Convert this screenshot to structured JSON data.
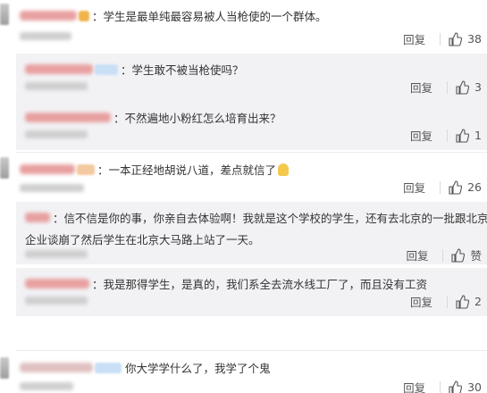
{
  "comments": [
    {
      "text": "学生是最单纯最容易被人当枪使的一个群体。",
      "reply": "回复",
      "likes": "38"
    },
    {
      "text": "学生敢不被当枪使吗？",
      "reply": "回复",
      "likes": "3"
    },
    {
      "text": "不然遍地小粉红怎么培育出来？",
      "reply": "回复",
      "likes": "1"
    },
    {
      "text": "一本正经地胡说八道，差点就信了",
      "reply": "回复",
      "likes": "26"
    },
    {
      "text_line1": "信不信是你的事，你亲自去体验啊！我就是这个学校的学生，还有去北京的一批跟北京",
      "text_line2": "企业谈崩了然后学生在北京大马路上站了一天。",
      "reply": "回复",
      "likes": "赞"
    },
    {
      "text": "我是那得学生，是真的，我们系全去流水线工厂了，而且没有工资",
      "reply": "回复",
      "likes": "2"
    },
    {
      "text": "你大学学什么了，我学了个鬼",
      "reply": "回复",
      "likes": "30"
    }
  ],
  "colors": {
    "reply_bg": "#f2f2f5",
    "accent": "#333333",
    "badge": "#e6a23c",
    "emoji": "#f2c94c"
  }
}
